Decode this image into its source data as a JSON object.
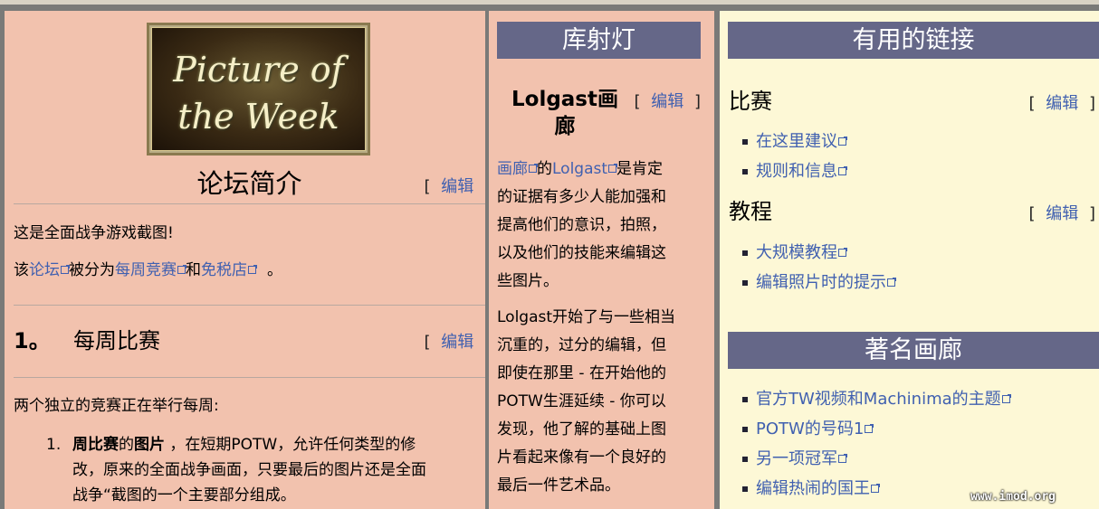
{
  "left": {
    "logo_text_line1": "Picture of",
    "logo_text_line2": "the Week",
    "intro_title": "论坛简介",
    "edit_label": "编辑",
    "bracket_open": "[",
    "bracket_close": "]",
    "intro_line1": "这是全面战争游戏截图!",
    "intro_line2_prefix": "该",
    "intro_link_forum": "论坛",
    "intro_line2_mid": "被分为",
    "intro_link_weekly": "每周竞赛",
    "intro_line2_and": "和",
    "intro_link_dutyfree": "免税店",
    "intro_line2_end": "。",
    "section_number": "1。",
    "section_title": "每周比赛",
    "section_desc": "两个独立的竞赛正在举行每周:",
    "list_marker": "1.",
    "list_bold1": "周比赛",
    "list_text1": "的",
    "list_bold2": "图片",
    "list_text2": " ，在短期POTW，允许任何类型的修",
    "list_text3": "改，原来的全面战争画面，只要最后的图片还是全面",
    "list_text4": "战争“截图的一个主要部分组成。"
  },
  "middle": {
    "banner": "库射灯",
    "title_line1": "Lolgast画",
    "title_line2": "廊",
    "edit_label": "编辑",
    "link_gallery": "画廊",
    "text_of": "的",
    "link_lolgast": "Lolgast",
    "para1_rest1": "是肯定",
    "para1_lines": [
      "的证据有多少人能加强和",
      "提高他们的意识，拍照，",
      "以及他们的技能来编辑这",
      "些图片。"
    ],
    "para2_lines": [
      "Lolgast开始了与一些相当",
      "沉重的，过分的编辑，但",
      "即使在那里 - 在开始他的",
      "POTW生涯延续 - 你可以",
      "发现，他了解的基础上图",
      "片看起来像有一个良好的",
      "最后一件艺术品。"
    ]
  },
  "right": {
    "banner1": "有用的链接",
    "heading_contest": "比赛",
    "edit_label": "编辑",
    "contest_links": [
      "在这里建议",
      "规则和信息"
    ],
    "heading_tutorial": "教程",
    "tutorial_links": [
      "大规模教程",
      "编辑照片时的提示"
    ],
    "banner2": "著名画廊",
    "gallery_links": [
      "官方TW视频和Machinima的主题",
      "POTW的号码1",
      "另一项冠军",
      "编辑热闹的国王"
    ],
    "watermark": "www.imod.org"
  }
}
